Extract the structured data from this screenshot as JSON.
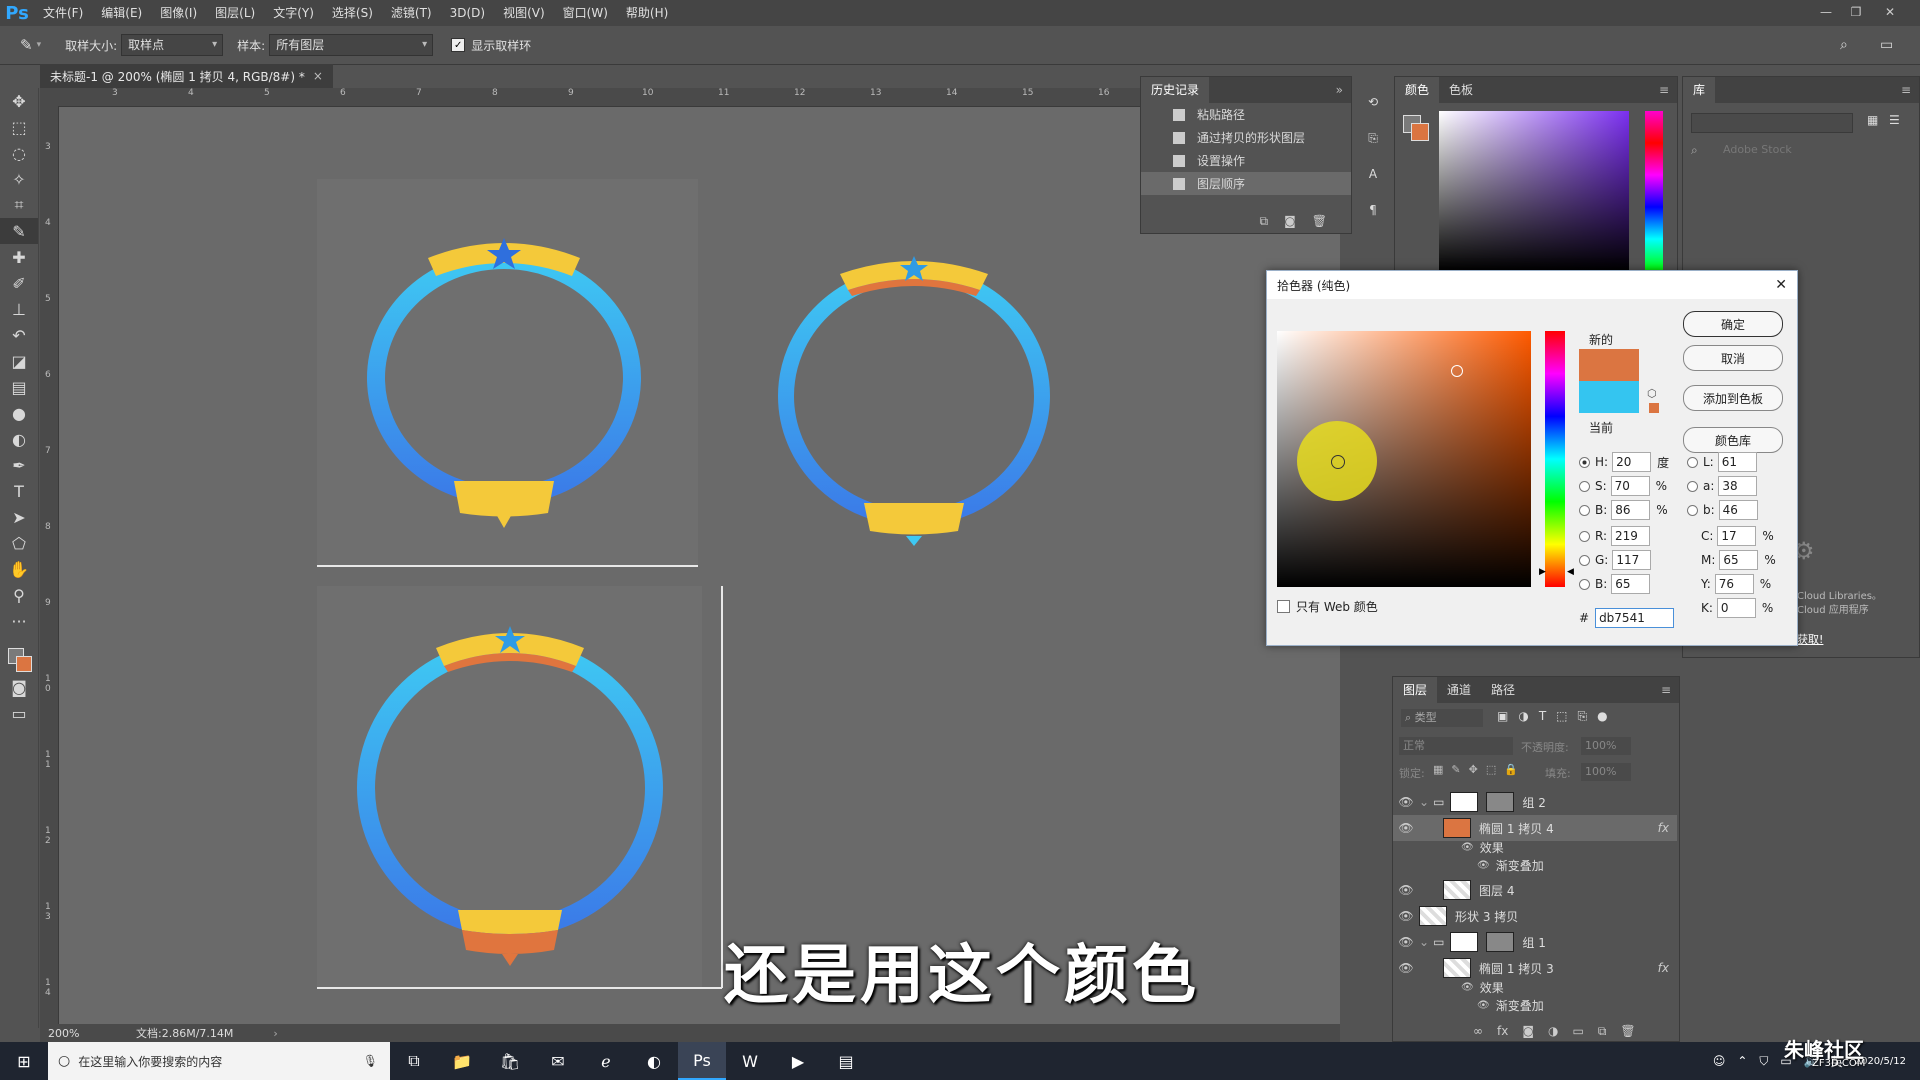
{
  "app": {
    "logo": "Ps"
  },
  "menu": [
    "文件(F)",
    "编辑(E)",
    "图像(I)",
    "图层(L)",
    "文字(Y)",
    "选择(S)",
    "滤镜(T)",
    "3D(D)",
    "视图(V)",
    "窗口(W)",
    "帮助(H)"
  ],
  "options": {
    "sample_size_label": "取样大小:",
    "sample_size_value": "取样点",
    "sample_label": "样本:",
    "sample_value": "所有图层",
    "show_ring_label": "显示取样环"
  },
  "document": {
    "tab_title": "未标题-1 @ 200% (椭圆 1 拷贝 4, RGB/8#) *"
  },
  "ruler": {
    "h_ticks": [
      "3",
      "4",
      "5",
      "6",
      "7",
      "8",
      "9",
      "10",
      "11",
      "12",
      "13",
      "14",
      "15",
      "16"
    ],
    "v_ticks": [
      "3",
      "4",
      "5",
      "6",
      "7",
      "8",
      "9",
      "1\n0",
      "1\n1",
      "1\n2",
      "1\n3",
      "1\n4"
    ]
  },
  "status": {
    "zoom": "200%",
    "doc_info": "文档:2.86M/7.14M"
  },
  "history": {
    "tab": "历史记录",
    "items": [
      "粘贴路径",
      "通过拷贝的形状图层",
      "设置操作",
      "图层顺序"
    ]
  },
  "color_panel": {
    "tabs": [
      "颜色",
      "色板"
    ]
  },
  "library_panel": {
    "tab": "库",
    "search_placeholder": "Adobe Stock",
    "cc_text_1": "Cloud Libraries。",
    "cc_text_2": "Cloud 应用程序",
    "cc_link": "获取!"
  },
  "color_picker": {
    "title": "拾色器 (纯色)",
    "new_label": "新的",
    "current_label": "当前",
    "new_color": "#db7541",
    "current_color": "#34c5f0",
    "buttons": {
      "ok": "确定",
      "cancel": "取消",
      "add_swatch": "添加到色板",
      "color_lib": "颜色库"
    },
    "web_only_label": "只有 Web 颜色",
    "hsb": {
      "h_label": "H:",
      "h": "20",
      "h_unit": "度",
      "s_label": "S:",
      "s": "70",
      "s_unit": "%",
      "b_label": "B:",
      "b": "86",
      "b_unit": "%"
    },
    "rgb": {
      "r_label": "R:",
      "r": "219",
      "g_label": "G:",
      "g": "117",
      "b_label": "B:",
      "b": "65"
    },
    "lab": {
      "l_label": "L:",
      "l": "61",
      "a_label": "a:",
      "a": "38",
      "b_label": "b:",
      "b": "46"
    },
    "cmyk": {
      "c_label": "C:",
      "c": "17",
      "m_label": "M:",
      "m": "65",
      "y_label": "Y:",
      "y": "76",
      "k_label": "K:",
      "k": "0",
      "unit": "%"
    },
    "hex_label": "#",
    "hex": "db7541"
  },
  "layers": {
    "tabs": [
      "图层",
      "通道",
      "路径"
    ],
    "filter_label": "类型",
    "blend_mode": "正常",
    "opacity_label": "不透明度:",
    "opacity": "100%",
    "lock_label": "锁定:",
    "fill_label": "填充:",
    "fill": "100%",
    "rows": [
      {
        "name": "组 2",
        "indent": 0,
        "kind": "group"
      },
      {
        "name": "椭圆 1 拷贝 4",
        "indent": 1,
        "kind": "shape",
        "fx": "fx",
        "selected": true
      },
      {
        "name": "效果",
        "indent": 2,
        "kind": "effect"
      },
      {
        "name": "渐变叠加",
        "indent": 3,
        "kind": "effect"
      },
      {
        "name": "图层 4",
        "indent": 1,
        "kind": "raster"
      },
      {
        "name": "形状 3 拷贝",
        "indent": 0,
        "kind": "shape"
      },
      {
        "name": "组 1",
        "indent": 0,
        "kind": "group"
      },
      {
        "name": "椭圆 1 拷贝 3",
        "indent": 1,
        "kind": "shape",
        "fx": "fx"
      },
      {
        "name": "效果",
        "indent": 2,
        "kind": "effect"
      },
      {
        "name": "渐变叠加",
        "indent": 3,
        "kind": "effect"
      }
    ]
  },
  "taskbar": {
    "search_placeholder": "在这里输入你要搜索的内容",
    "ime": "英",
    "date": "2020/5/12"
  },
  "watermark": {
    "brand": "朱峰社区",
    "url": "ZF3D.COM"
  },
  "subtitle": "还是用这个颜色"
}
